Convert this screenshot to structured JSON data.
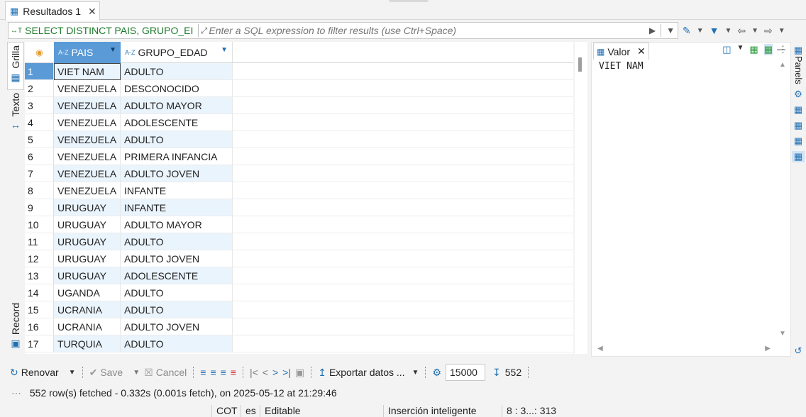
{
  "tab": {
    "label": "Resultados 1"
  },
  "filter": {
    "sql": "SELECT DISTINCT PAIS, GRUPO_EI",
    "placeholder": "Enter a SQL expression to filter results (use Ctrl+Space)"
  },
  "side_tabs": {
    "grid": "Grilla",
    "text": "Texto",
    "record": "Record"
  },
  "columns": [
    {
      "prefix": "A-Z",
      "label": "PAIS"
    },
    {
      "prefix": "A-Z",
      "label": "GRUPO_EDAD"
    }
  ],
  "rows": [
    {
      "n": "1",
      "pais": "VIET NAM",
      "grupo": "ADULTO"
    },
    {
      "n": "2",
      "pais": "VENEZUELA",
      "grupo": "DESCONOCIDO"
    },
    {
      "n": "3",
      "pais": "VENEZUELA",
      "grupo": "ADULTO MAYOR"
    },
    {
      "n": "4",
      "pais": "VENEZUELA",
      "grupo": "ADOLESCENTE"
    },
    {
      "n": "5",
      "pais": "VENEZUELA",
      "grupo": "ADULTO"
    },
    {
      "n": "6",
      "pais": "VENEZUELA",
      "grupo": "PRIMERA INFANCIA"
    },
    {
      "n": "7",
      "pais": "VENEZUELA",
      "grupo": "ADULTO JOVEN"
    },
    {
      "n": "8",
      "pais": "VENEZUELA",
      "grupo": "INFANTE"
    },
    {
      "n": "9",
      "pais": "URUGUAY",
      "grupo": "INFANTE"
    },
    {
      "n": "10",
      "pais": "URUGUAY",
      "grupo": "ADULTO MAYOR"
    },
    {
      "n": "11",
      "pais": "URUGUAY",
      "grupo": "ADULTO"
    },
    {
      "n": "12",
      "pais": "URUGUAY",
      "grupo": "ADULTO JOVEN"
    },
    {
      "n": "13",
      "pais": "URUGUAY",
      "grupo": "ADOLESCENTE"
    },
    {
      "n": "14",
      "pais": "UGANDA",
      "grupo": "ADULTO"
    },
    {
      "n": "15",
      "pais": "UCRANIA",
      "grupo": "ADULTO"
    },
    {
      "n": "16",
      "pais": "UCRANIA",
      "grupo": "ADULTO JOVEN"
    },
    {
      "n": "17",
      "pais": "TURQUIA",
      "grupo": "ADULTO"
    }
  ],
  "value_panel": {
    "title": "Valor",
    "content": "VIET NAM"
  },
  "right_panels": {
    "label": "Panels"
  },
  "toolbar": {
    "refresh": "Renovar",
    "save": "Save",
    "cancel": "Cancel",
    "export": "Exportar datos ...",
    "fetch_size": "15000",
    "row_count": "552"
  },
  "status": {
    "fetched": "552 row(s) fetched - 0.332s (0.001s fetch), on 2025-05-12 at 21:29:46"
  },
  "statusbar": {
    "tz": "COT",
    "locale": "es",
    "mode": "Editable",
    "insert": "Inserción inteligente",
    "position": "8 : 3...: 313"
  },
  "colors": {
    "selected_header": "#5a9ad6",
    "alt_row": "#eaf4fd",
    "sql_green": "#1d7a2a",
    "accent": "#1f6fb3"
  }
}
